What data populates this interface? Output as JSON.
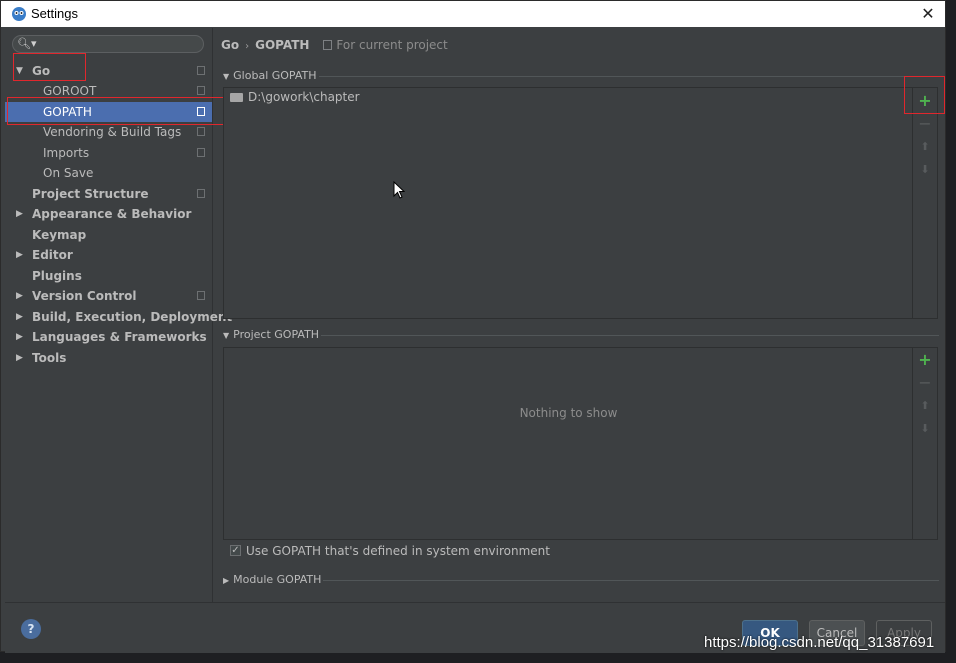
{
  "window": {
    "title": "Settings",
    "close_glyph": "✕"
  },
  "sidebar": {
    "search_placeholder": "",
    "items": [
      {
        "label": "Go",
        "bold": true,
        "expanded": true
      },
      {
        "label": "GOROOT"
      },
      {
        "label": "GOPATH",
        "selected": true
      },
      {
        "label": "Vendoring & Build Tags"
      },
      {
        "label": "Imports"
      },
      {
        "label": "On Save"
      },
      {
        "label": "Project Structure",
        "bold": true
      },
      {
        "label": "Appearance & Behavior",
        "bold": true
      },
      {
        "label": "Keymap",
        "bold": true
      },
      {
        "label": "Editor",
        "bold": true
      },
      {
        "label": "Plugins",
        "bold": true
      },
      {
        "label": "Version Control",
        "bold": true
      },
      {
        "label": "Build, Execution, Deployment",
        "bold": true
      },
      {
        "label": "Languages & Frameworks",
        "bold": true
      },
      {
        "label": "Tools",
        "bold": true
      }
    ]
  },
  "breadcrumb": {
    "root": "Go",
    "separator": "›",
    "page": "GOPATH",
    "scope": "For current project"
  },
  "global_gopath": {
    "title": "Global GOPATH",
    "paths": [
      "D:\\gowork\\chapter"
    ]
  },
  "project_gopath": {
    "title": "Project GOPATH",
    "empty_text": "Nothing to show"
  },
  "system_env_checkbox": {
    "label": "Use GOPATH that's defined in system environment",
    "checked": true,
    "mark": "✓"
  },
  "module_gopath": {
    "title": "Module GOPATH"
  },
  "toolbar_icons": {
    "add": "+",
    "remove": "−",
    "up": "⬆",
    "down": "⬇"
  },
  "footer": {
    "help": "?",
    "ok": "OK",
    "cancel": "Cancel",
    "apply": "Apply"
  },
  "watermark": "https://blog.csdn.net/qq_31387691",
  "colors": {
    "accent": "#4b6eaf",
    "highlight_box": "#e0272d",
    "add_green": "#4fb34f"
  }
}
